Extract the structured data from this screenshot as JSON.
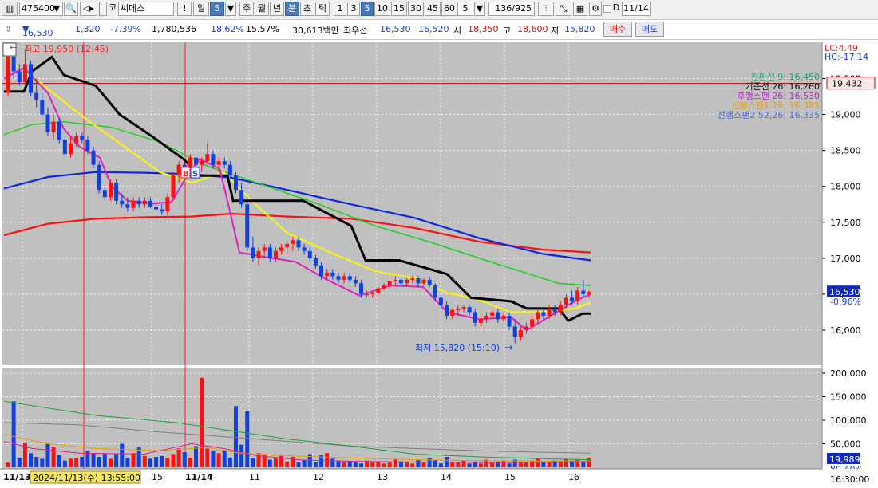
{
  "toolbar": {
    "code": "475400",
    "name": "씨메스",
    "market_prefix": "코",
    "bang": "!",
    "period_il": "일",
    "period_value": "5",
    "tabs": [
      "주",
      "월",
      "년",
      "분",
      "초",
      "틱"
    ],
    "active_tab": "분",
    "minutes": [
      "1",
      "3",
      "5",
      "10",
      "15",
      "30",
      "45",
      "60"
    ],
    "active_minute": "5",
    "count_value": "5",
    "page_info": "136/925",
    "d_label": "D",
    "date_value": "11/14"
  },
  "info": {
    "price": "16,530",
    "change": "1,320",
    "change_pct": "-7.39%",
    "volume": "1,780,536",
    "turnover_pct": "18.62%",
    "vol_ratio": "15.57%",
    "amount": "30,613백만",
    "best_bid_label": "최우선",
    "best_ask": "16,530",
    "best_bid": "16,520",
    "open_label": "시",
    "open": "18,350",
    "high_label": "고",
    "high": "18,600",
    "low_label": "저",
    "low": "15,820",
    "buy_label": "매수",
    "sell_label": "매도"
  },
  "chart": {
    "lc_text": "LC:4.49",
    "hc_text": "HC:-17.14",
    "high_marker": "최고 19,950 (12:45)",
    "low_marker": "최저 15,820 (15:10)",
    "buy_sig": "B",
    "sell_sig": "S",
    "legend": [
      {
        "text": "전환선 9: 16,450",
        "color": "#22a070"
      },
      {
        "text": "기준선 26: 16,260",
        "color": "#111111"
      },
      {
        "text": "후행스팬 26: 16,530",
        "color": "#b030c0"
      },
      {
        "text": "선행스팬1 26: 16,385",
        "color": "#e0a020"
      },
      {
        "text": "선행스팬2 52,26: 16,335",
        "color": "#5070e0"
      }
    ],
    "price_axis": [
      "19,500",
      "19,000",
      "18,500",
      "18,000",
      "17,500",
      "17,000",
      "16,500",
      "16,000"
    ],
    "ref_price": "19,432",
    "cur_price": "16,530",
    "cur_pct": "-0.96%",
    "vol_axis": [
      "200,000",
      "150,000",
      "100,000",
      "50,000"
    ],
    "vol_cur": "19,989",
    "vol_pct": "80.40%",
    "date_tip": "2024/11/13(수) 13:55:00",
    "x_labels": [
      {
        "text": "11/13",
        "bold": true
      },
      {
        "text": "15",
        "bold": false
      },
      {
        "text": "11/14",
        "bold": true
      },
      {
        "text": "11",
        "bold": false
      },
      {
        "text": "12",
        "bold": false
      },
      {
        "text": "13",
        "bold": false
      },
      {
        "text": "14",
        "bold": false
      },
      {
        "text": "15",
        "bold": false
      },
      {
        "text": "16",
        "bold": false
      }
    ],
    "time_label": "16:30:00"
  },
  "chart_data": {
    "type": "candlestick",
    "price_range": [
      15600,
      19950
    ],
    "volume_range": [
      0,
      210000
    ],
    "ohlc": [
      [
        19300,
        19950,
        19250,
        19800
      ],
      [
        19800,
        19850,
        19500,
        19600
      ],
      [
        19600,
        19700,
        19400,
        19450
      ],
      [
        19450,
        19900,
        19400,
        19700
      ],
      [
        19700,
        19750,
        19250,
        19300
      ],
      [
        19300,
        19500,
        19100,
        19200
      ],
      [
        19200,
        19300,
        18950,
        19000
      ],
      [
        19000,
        19100,
        18700,
        18750
      ],
      [
        18750,
        19000,
        18650,
        18900
      ],
      [
        18900,
        18950,
        18600,
        18650
      ],
      [
        18650,
        18700,
        18400,
        18450
      ],
      [
        18450,
        18700,
        18400,
        18600
      ],
      [
        18600,
        18750,
        18550,
        18700
      ],
      [
        18700,
        18750,
        18600,
        18650
      ],
      [
        18650,
        18700,
        18450,
        18500
      ],
      [
        18500,
        18550,
        18250,
        18300
      ],
      [
        18300,
        18350,
        17900,
        17950
      ],
      [
        17950,
        18000,
        17800,
        17850
      ],
      [
        17850,
        18100,
        17800,
        18050
      ],
      [
        18050,
        18100,
        17750,
        17800
      ],
      [
        17800,
        17900,
        17700,
        17750
      ],
      [
        17750,
        17850,
        17650,
        17700
      ],
      [
        17700,
        17850,
        17650,
        17800
      ],
      [
        17800,
        17850,
        17700,
        17750
      ],
      [
        17750,
        17850,
        17700,
        17800
      ],
      [
        17800,
        17850,
        17700,
        17720
      ],
      [
        17720,
        17800,
        17650,
        17680
      ],
      [
        17680,
        17750,
        17600,
        17650
      ],
      [
        17650,
        17900,
        17600,
        17850
      ],
      [
        17850,
        18200,
        17800,
        18150
      ],
      [
        18150,
        18350,
        18050,
        18300
      ],
      [
        18300,
        18350,
        18150,
        18200
      ],
      [
        18200,
        18450,
        18150,
        18400
      ],
      [
        18400,
        18450,
        18250,
        18300
      ],
      [
        18300,
        18400,
        18200,
        18350
      ],
      [
        18350,
        18600,
        18300,
        18450
      ],
      [
        18450,
        18500,
        18250,
        18300
      ],
      [
        18300,
        18400,
        18200,
        18350
      ],
      [
        18350,
        18400,
        18250,
        18300
      ],
      [
        18300,
        18350,
        18100,
        18150
      ],
      [
        18150,
        18200,
        17900,
        17950
      ],
      [
        17950,
        18050,
        17700,
        17750
      ],
      [
        17750,
        17850,
        17100,
        17150
      ],
      [
        17150,
        17300,
        16950,
        17000
      ],
      [
        17000,
        17150,
        16900,
        17100
      ],
      [
        17100,
        17200,
        17000,
        17150
      ],
      [
        17150,
        17200,
        16950,
        17000
      ],
      [
        17000,
        17150,
        16950,
        17100
      ],
      [
        17100,
        17200,
        17050,
        17150
      ],
      [
        17150,
        17250,
        17050,
        17200
      ],
      [
        17200,
        17300,
        17100,
        17250
      ],
      [
        17250,
        17300,
        17100,
        17150
      ],
      [
        17150,
        17200,
        17050,
        17100
      ],
      [
        17100,
        17150,
        16950,
        17000
      ],
      [
        17000,
        17050,
        16850,
        16900
      ],
      [
        16900,
        16950,
        16700,
        16750
      ],
      [
        16750,
        16850,
        16700,
        16800
      ],
      [
        16800,
        16850,
        16700,
        16750
      ],
      [
        16750,
        16800,
        16650,
        16700
      ],
      [
        16700,
        16800,
        16650,
        16750
      ],
      [
        16750,
        16800,
        16650,
        16700
      ],
      [
        16700,
        16750,
        16600,
        16650
      ],
      [
        16650,
        16700,
        16450,
        16500
      ],
      [
        16500,
        16550,
        16450,
        16500
      ],
      [
        16500,
        16550,
        16450,
        16520
      ],
      [
        16520,
        16600,
        16480,
        16580
      ],
      [
        16580,
        16650,
        16550,
        16620
      ],
      [
        16620,
        16700,
        16580,
        16680
      ],
      [
        16680,
        16750,
        16620,
        16700
      ],
      [
        16700,
        16750,
        16600,
        16650
      ],
      [
        16650,
        16720,
        16600,
        16700
      ],
      [
        16700,
        16750,
        16650,
        16720
      ],
      [
        16720,
        16750,
        16600,
        16650
      ],
      [
        16650,
        16720,
        16620,
        16700
      ],
      [
        16700,
        16750,
        16600,
        16620
      ],
      [
        16620,
        16650,
        16400,
        16450
      ],
      [
        16450,
        16500,
        16300,
        16350
      ],
      [
        16350,
        16400,
        16150,
        16200
      ],
      [
        16200,
        16300,
        16150,
        16280
      ],
      [
        16280,
        16350,
        16200,
        16300
      ],
      [
        16300,
        16350,
        16250,
        16320
      ],
      [
        16320,
        16350,
        16200,
        16250
      ],
      [
        16250,
        16300,
        16050,
        16100
      ],
      [
        16100,
        16200,
        16050,
        16150
      ],
      [
        16150,
        16250,
        16100,
        16200
      ],
      [
        16200,
        16300,
        16150,
        16250
      ],
      [
        16250,
        16300,
        16100,
        16150
      ],
      [
        16150,
        16250,
        16120,
        16200
      ],
      [
        16200,
        16250,
        16000,
        16050
      ],
      [
        16050,
        16150,
        15820,
        15900
      ],
      [
        15900,
        16050,
        15850,
        16000
      ],
      [
        16000,
        16100,
        15950,
        16050
      ],
      [
        16050,
        16200,
        16000,
        16150
      ],
      [
        16150,
        16300,
        16100,
        16250
      ],
      [
        16250,
        16300,
        16150,
        16200
      ],
      [
        16200,
        16350,
        16150,
        16300
      ],
      [
        16300,
        16350,
        16200,
        16250
      ],
      [
        16250,
        16400,
        16200,
        16350
      ],
      [
        16350,
        16500,
        16300,
        16450
      ],
      [
        16450,
        16550,
        16350,
        16400
      ],
      [
        16400,
        16600,
        16350,
        16550
      ],
      [
        16550,
        16700,
        16450,
        16500
      ],
      [
        16500,
        16550,
        16450,
        16530
      ]
    ],
    "volumes": [
      10,
      140,
      20,
      52,
      30,
      22,
      18,
      50,
      44,
      26,
      14,
      18,
      20,
      22,
      35,
      30,
      22,
      30,
      18,
      28,
      50,
      20,
      30,
      42,
      24,
      18,
      22,
      24,
      20,
      28,
      40,
      32,
      20,
      45,
      190,
      40,
      36,
      30,
      36,
      20,
      130,
      48,
      120,
      20,
      30,
      28,
      16,
      20,
      24,
      12,
      22,
      10,
      16,
      28,
      10,
      26,
      30,
      18,
      14,
      10,
      12,
      10,
      8,
      14,
      10,
      12,
      8,
      10,
      18,
      12,
      10,
      8,
      16,
      10,
      20,
      16,
      8,
      22,
      12,
      10,
      14,
      8,
      12,
      8,
      16,
      10,
      12,
      14,
      8,
      16,
      10,
      12,
      14,
      18,
      12,
      10,
      14,
      12,
      18,
      14,
      16,
      12,
      20
    ],
    "series": [
      {
        "name": "전환선 9",
        "color": "#22a070",
        "last": 16450
      },
      {
        "name": "기준선 26",
        "color": "#111111",
        "last": 16260
      },
      {
        "name": "후행스팬 26",
        "color": "#b030c0",
        "last": 16530
      },
      {
        "name": "선행스팬1 26",
        "color": "#e0a020",
        "last": 16385
      },
      {
        "name": "선행스팬2 52,26",
        "color": "#5070e0",
        "last": 16335
      }
    ]
  }
}
